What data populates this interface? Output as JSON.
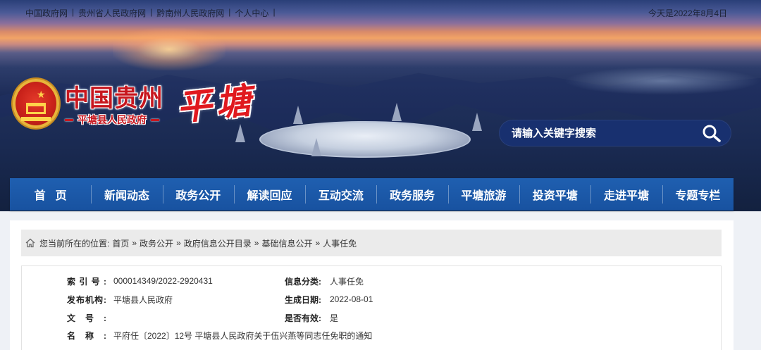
{
  "top_links": [
    "中国政府网",
    "贵州省人民政府网",
    "黔南州人民政府网",
    "个人中心"
  ],
  "separator": "|",
  "date_text": "今天是2022年8月4日",
  "brand": {
    "title": "中国贵州",
    "subtitle": "平塘县人民政府",
    "county_art": "平塘"
  },
  "search": {
    "placeholder": "请输入关键字搜索"
  },
  "nav": [
    "首页",
    "新闻动态",
    "政务公开",
    "解读回应",
    "互动交流",
    "政务服务",
    "平塘旅游",
    "投资平塘",
    "走进平塘",
    "专题专栏"
  ],
  "breadcrumb": {
    "prefix": "您当前所在的位置:",
    "items": [
      "首页",
      "政务公开",
      "政府信息公开目录",
      "基础信息公开",
      "人事任免"
    ],
    "separator": "»"
  },
  "info": {
    "index_label": "索引号:",
    "index_value": "000014349/2022-2920431",
    "category_label": "信息分类:",
    "category_value": "人事任免",
    "publisher_label": "发布机构:",
    "publisher_value": "平塘县人民政府",
    "date_label": "生成日期:",
    "date_value": "2022-08-01",
    "docno_label": "文号:",
    "docno_value": "",
    "valid_label": "是否有效:",
    "valid_value": "是",
    "name_label": "名称:",
    "name_value": "平府任〔2022〕12号 平塘县人民政府关于伍兴燕等同志任免职的通知"
  },
  "colors": {
    "nav_bg": "#1f5fb0",
    "brand_red": "#c7161e",
    "search_bg": "#18306f"
  }
}
